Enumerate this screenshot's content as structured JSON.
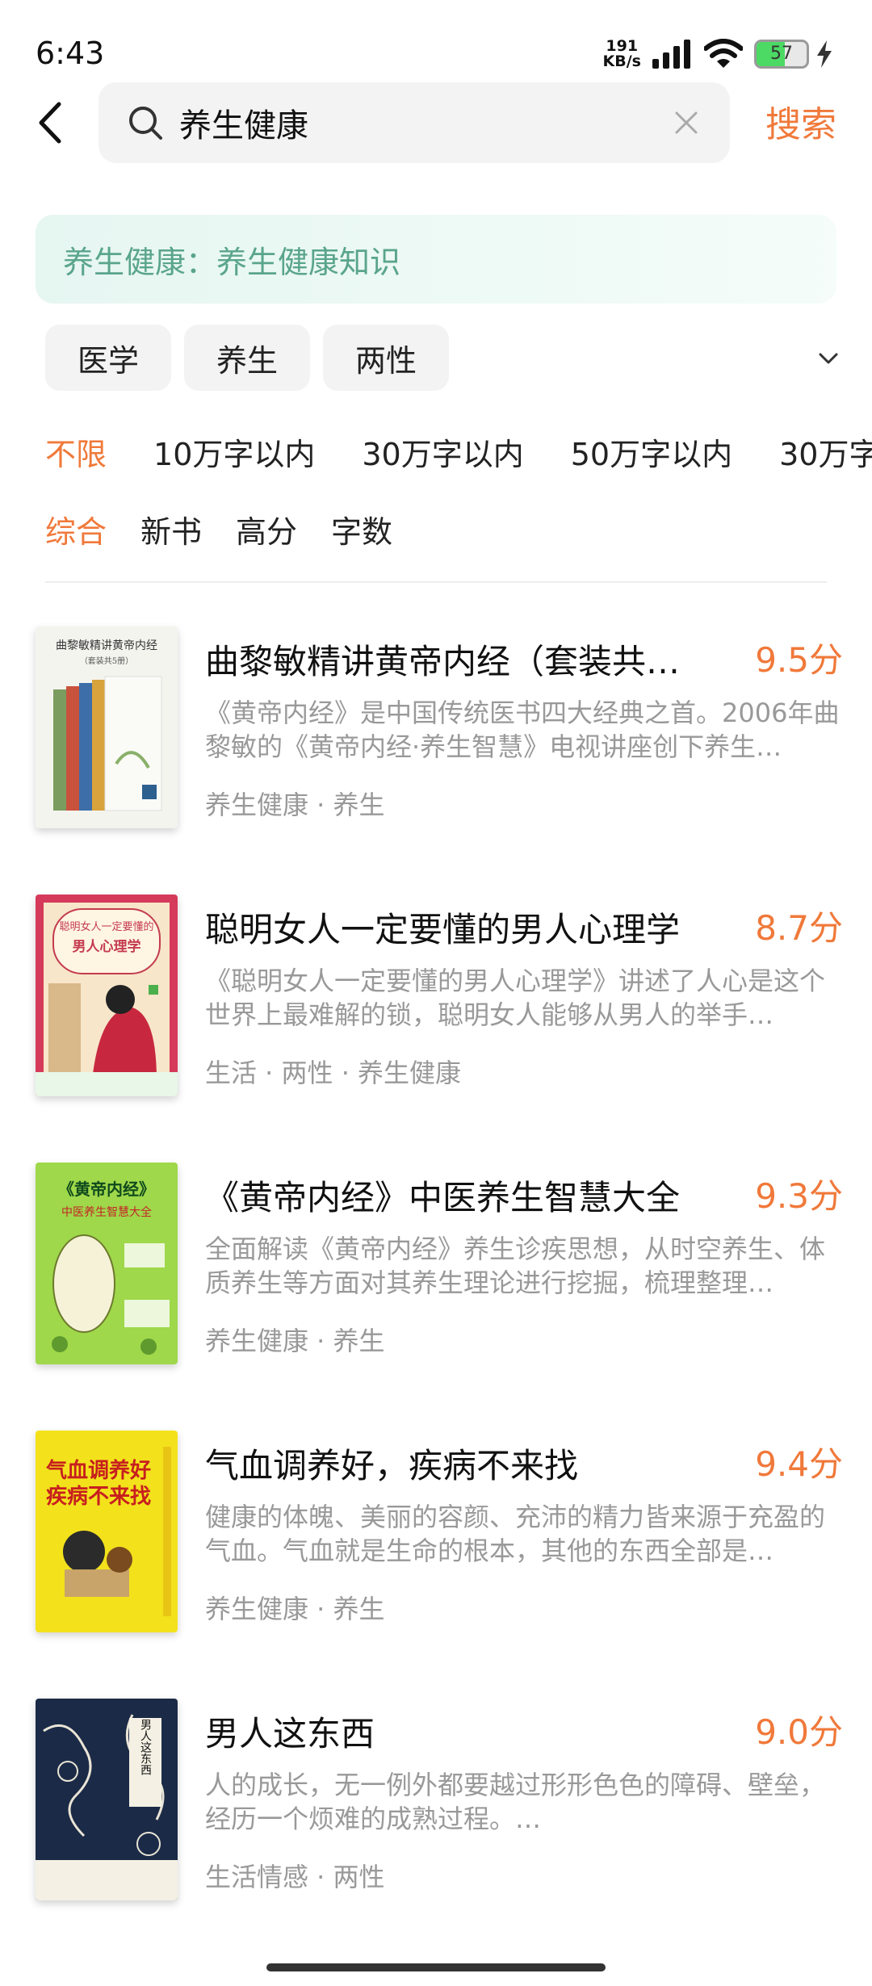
{
  "status": {
    "time": "6:43",
    "speed_value": "191",
    "speed_unit": "KB/s",
    "battery": "57",
    "battery_level": 0.57
  },
  "search": {
    "query": "养生健康",
    "button_label": "搜索"
  },
  "suggestion": "养生健康：养生健康知识",
  "tags": [
    "医学",
    "养生",
    "两性"
  ],
  "word_filters": [
    "不限",
    "10万字以内",
    "30万字以内",
    "50万字以内",
    "30万字"
  ],
  "sort_filters": [
    "综合",
    "新书",
    "高分",
    "字数"
  ],
  "books": [
    {
      "title": "曲黎敏精讲黄帝内经（套装共…",
      "score": "9.5分",
      "desc": "《黄帝内经》是中国传统医书四大经典之首。2006年曲黎敏的《黄帝内经·养生智慧》电视讲座创下养生…",
      "tags": "养生健康 · 养生",
      "cover_text": "曲黎敏精讲黄帝内经",
      "cover_sub": "（套装共5册）"
    },
    {
      "title": "聪明女人一定要懂的男人心理学",
      "score": "8.7分",
      "desc": "《聪明女人一定要懂的男人心理学》讲述了人心是这个世界上最难解的锁，聪明女人能够从男人的举手…",
      "tags": "生活 · 两性 · 养生健康",
      "cover_text": "聪明女人一定要懂的",
      "cover_sub": "男人心理学"
    },
    {
      "title": "《黄帝内经》中医养生智慧大全",
      "score": "9.3分",
      "desc": "全面解读《黄帝内经》养生诊疾思想，从时空养生、体质养生等方面对其养生理论进行挖掘，梳理整理…",
      "tags": "养生健康 · 养生",
      "cover_text": "《黄帝内经》",
      "cover_sub": "中医养生智慧大全"
    },
    {
      "title": "气血调养好，疾病不来找",
      "score": "9.4分",
      "desc": "健康的体魄、美丽的容颜、充沛的精力皆来源于充盈的气血。气血就是生命的根本，其他的东西全部是…",
      "tags": "养生健康 · 养生",
      "cover_text": "气血调养好",
      "cover_sub": "疾病不来找"
    },
    {
      "title": "男人这东西",
      "score": "9.0分",
      "desc": "人的成长，无一例外都要越过形形色色的障碍、壁垒，经历一个烦难的成熟过程。…",
      "tags": "生活情感 · 两性",
      "cover_text": "男人这东西",
      "cover_sub": ""
    }
  ],
  "colors": {
    "accent": "#f0793a",
    "suggest_text": "#5aa58c",
    "muted": "#999999"
  }
}
